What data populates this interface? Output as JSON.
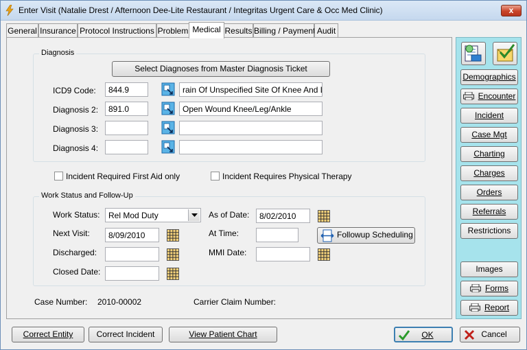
{
  "window": {
    "title": "Enter Visit (Natalie Drest / Afternoon Dee-Lite Restaurant / Integritas Urgent Care & Occ Med Clinic)",
    "close_label": "x"
  },
  "tabs": [
    {
      "label": "General"
    },
    {
      "label": "Insurance"
    },
    {
      "label": "Protocol Instructions"
    },
    {
      "label": "Problem"
    },
    {
      "label": "Medical"
    },
    {
      "label": "Results"
    },
    {
      "label": "Billing / Payment"
    },
    {
      "label": "Audit"
    }
  ],
  "diagnosis": {
    "group_title": "Diagnosis",
    "select_button": "Select Diagnoses from Master Diagnosis Ticket",
    "rows": [
      {
        "label": "ICD9 Code:",
        "code": "844.9",
        "description": "rain Of Unspecified Site Of Knee And Leg"
      },
      {
        "label": "Diagnosis 2:",
        "code": "891.0",
        "description": "Open Wound Knee/Leg/Ankle"
      },
      {
        "label": "Diagnosis 3:",
        "code": "",
        "description": ""
      },
      {
        "label": "Diagnosis 4:",
        "code": "",
        "description": ""
      }
    ]
  },
  "checks": {
    "first_aid": "Incident Required First Aid only",
    "physical_therapy": "Incident Requires Physical Therapy"
  },
  "work": {
    "group_title": "Work Status and Follow-Up",
    "work_status_label": "Work Status:",
    "work_status_value": "Rel Mod Duty",
    "next_visit_label": "Next Visit:",
    "next_visit_value": "8/09/2010",
    "discharged_label": "Discharged:",
    "discharged_value": "",
    "closed_label": "Closed Date:",
    "closed_value": "",
    "as_of_label": "As of Date:",
    "as_of_value": "8/02/2010",
    "at_time_label": "At Time:",
    "at_time_value": "",
    "mmi_label": "MMI Date:",
    "mmi_value": "",
    "followup_button": "Followup Scheduling"
  },
  "case": {
    "case_number_label": "Case Number:",
    "case_number_value": "2010-00002",
    "carrier_label": "Carrier Claim Number:"
  },
  "sidebar": {
    "demographics": "Demographics",
    "encounter": "Encounter",
    "incident": "Incident",
    "case_mgt": "Case Mgt",
    "charting": "Charting",
    "charges": "Charges",
    "orders": "Orders",
    "referrals": "Referrals",
    "restrictions": "Restrictions",
    "images": "Images",
    "forms": "Forms",
    "report": "Report"
  },
  "footer": {
    "correct_entity": "Correct Entity",
    "correct_incident": "Correct Incident",
    "view_chart": "View Patient Chart",
    "ok": "OK",
    "cancel": "Cancel"
  },
  "colors": {
    "sidebar_bg": "#a6e3ec",
    "titlebar": "#c5d8ee",
    "close_red": "#c9442a"
  }
}
